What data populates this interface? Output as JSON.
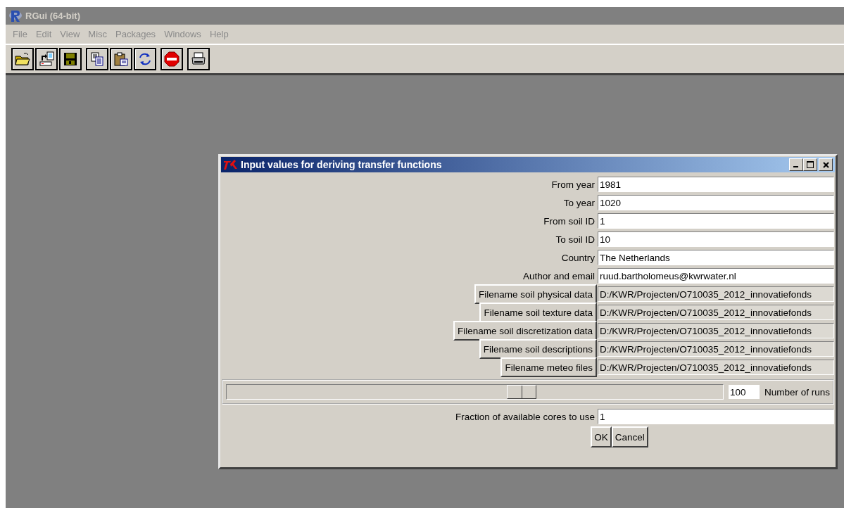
{
  "window": {
    "title": "RGui (64-bit)"
  },
  "menu": [
    {
      "label": "File",
      "disabled": true
    },
    {
      "label": "Edit",
      "disabled": true
    },
    {
      "label": "View",
      "disabled": true
    },
    {
      "label": "Misc",
      "disabled": true
    },
    {
      "label": "Packages",
      "disabled": true
    },
    {
      "label": "Windows",
      "disabled": true
    },
    {
      "label": "Help",
      "disabled": true
    }
  ],
  "dialog": {
    "title": "Input values for deriving transfer functions",
    "rows": [
      {
        "kind": "entry",
        "label": "From year",
        "value": "1981"
      },
      {
        "kind": "entry",
        "label": "To year",
        "value": "1020"
      },
      {
        "kind": "entry",
        "label": "From soil ID",
        "value": "1"
      },
      {
        "kind": "entry",
        "label": "To soil ID",
        "value": "10"
      },
      {
        "kind": "entry",
        "label": "Country",
        "value": "The Netherlands"
      },
      {
        "kind": "entry",
        "label": "Author and email",
        "value": "ruud.bartholomeus@kwrwater.nl"
      },
      {
        "kind": "file",
        "label": "Filename soil physical data",
        "value": "D:/KWR/Projecten/O710035_2012_innovatiefonds"
      },
      {
        "kind": "file",
        "label": "Filename soil texture data",
        "value": "D:/KWR/Projecten/O710035_2012_innovatiefonds"
      },
      {
        "kind": "file",
        "label": "Filename soil discretization data",
        "value": "D:/KWR/Projecten/O710035_2012_innovatiefonds"
      },
      {
        "kind": "file",
        "label": "Filename soil descriptions",
        "value": "D:/KWR/Projecten/O710035_2012_innovatiefonds"
      },
      {
        "kind": "file",
        "label": "Filename meteo files",
        "value": "D:/KWR/Projecten/O710035_2012_innovatiefonds"
      },
      {
        "kind": "slider",
        "level": 0.6,
        "value": "100",
        "label": "Number of runs"
      },
      {
        "kind": "entry",
        "label": "Fraction of available cores to use",
        "value": "1"
      }
    ],
    "buttons": [
      "OK",
      "Cancel"
    ]
  }
}
